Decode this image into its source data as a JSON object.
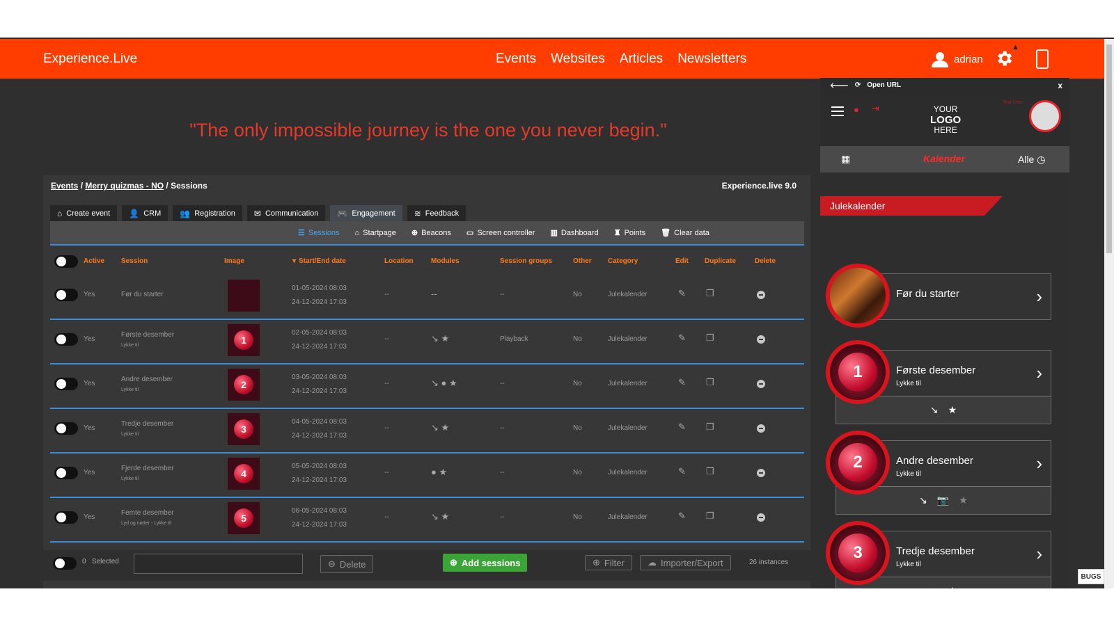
{
  "header": {
    "brand": "Experience.Live",
    "nav": [
      "Events",
      "Websites",
      "Articles",
      "Newsletters"
    ],
    "user": "adrian"
  },
  "quote": "\"The only impossible journey is the one you never begin.\"",
  "crumbs": {
    "events": "Events",
    "event": "Merry quizmas - NO",
    "current": "Sessions"
  },
  "version": "Experience.live 9.0",
  "tabs": [
    "Create event",
    "CRM",
    "Registration",
    "Communication",
    "Engagement",
    "Feedback"
  ],
  "subnav": [
    "Sessions",
    "Startpage",
    "Beacons",
    "Screen controller",
    "Dashboard",
    "Points",
    "Clear data"
  ],
  "columns": [
    "Active",
    "Session",
    "Image",
    "Start/End date",
    "Location",
    "Modules",
    "Session groups",
    "Other",
    "Category",
    "Edit",
    "Duplicate",
    "Delete"
  ],
  "rows": [
    {
      "active": "Yes",
      "name": "Før du starter",
      "sub": "",
      "start": "01-05-2024 08:03",
      "end": "24-12-2024 17:03",
      "location": "--",
      "modules": "--",
      "groups": "--",
      "other": "No",
      "category": "Julekalender",
      "num": ""
    },
    {
      "active": "Yes",
      "name": "Første desember",
      "sub": "Lykke til",
      "start": "02-05-2024 08:03",
      "end": "24-12-2024 17:03",
      "location": "--",
      "modules": "↘ ★",
      "groups": "Playback",
      "other": "No",
      "category": "Julekalender",
      "num": "1"
    },
    {
      "active": "Yes",
      "name": "Andre desember",
      "sub": "Lykke til",
      "start": "03-05-2024 08:03",
      "end": "24-12-2024 17:03",
      "location": "--",
      "modules": "↘ ● ★",
      "groups": "--",
      "other": "No",
      "category": "Julekalender",
      "num": "2"
    },
    {
      "active": "Yes",
      "name": "Tredje desember",
      "sub": "Lykke til",
      "start": "04-05-2024 08:03",
      "end": "24-12-2024 17:03",
      "location": "--",
      "modules": "↘ ★",
      "groups": "--",
      "other": "No",
      "category": "Julekalender",
      "num": "3"
    },
    {
      "active": "Yes",
      "name": "Fjerde desember",
      "sub": "Lykke til",
      "start": "05-05-2024 08:03",
      "end": "24-12-2024 17:03",
      "location": "--",
      "modules": "● ★",
      "groups": "--",
      "other": "No",
      "category": "Julekalender",
      "num": "4"
    },
    {
      "active": "Yes",
      "name": "Femte desember",
      "sub": "Lyd og nøtter - Lykke til",
      "start": "06-05-2024 08:03",
      "end": "24-12-2024 17:03",
      "location": "--",
      "modules": "↘ ★",
      "groups": "--",
      "other": "No",
      "category": "Julekalender",
      "num": "5"
    }
  ],
  "bottom": {
    "count": "0",
    "selected": "Selected",
    "delete": "Delete",
    "add": "Add sessions",
    "filter": "Filter",
    "import": "Importer/Export",
    "instances": "26 instances"
  },
  "preview": {
    "url_label": "Open URL",
    "close": "x",
    "logo_l1": "YOUR",
    "logo_l2": "LOGO",
    "logo_l3": "HERE",
    "test_user": "Test User",
    "calendar": "Kalender",
    "filter": "Alle",
    "banner": "Julekalender",
    "cards": [
      {
        "title": "Før du starter",
        "sub": "",
        "num": ""
      },
      {
        "title": "Første desember",
        "sub": "Lykke til",
        "num": "1"
      },
      {
        "title": "Andre desember",
        "sub": "Lykke til",
        "num": "2"
      },
      {
        "title": "Tredje desember",
        "sub": "Lykke til",
        "num": "3"
      }
    ]
  },
  "bugs": "BUGS"
}
